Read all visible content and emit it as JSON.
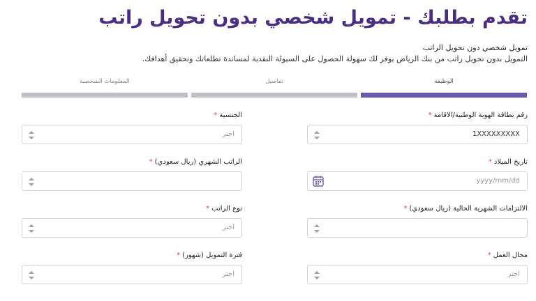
{
  "page": {
    "title": "تقدم بطلبك - تمويل شخصي بدون تحويل راتب",
    "subtitle": "تمويل شخصي دون تحويل الراتب",
    "description": "التمويل بدون تحويل راتب من بنك الرياض يوفر لك سهولة الحصول على السيولة النقدية لمساندة تطلعاتك وتحقيق أهدافك."
  },
  "steps": [
    {
      "label": "الوظيفة",
      "active": true
    },
    {
      "label": "تفاصيل",
      "active": false
    },
    {
      "label": "المعلومات الشخصية",
      "active": false
    }
  ],
  "form": {
    "required_mark": "*",
    "id_number": {
      "label": "رقم بطاقة الهوية الوطنية/الاقامة",
      "value": "1XXXXXXXXX"
    },
    "nationality": {
      "label": "الجنسية",
      "placeholder": "اختر"
    },
    "birth_date": {
      "label": "تاريخ الميلاد",
      "placeholder": "yyyy/mm/dd"
    },
    "monthly_salary": {
      "label": "الراتب الشهري (ريال سعودي)",
      "value": ""
    },
    "monthly_obligations": {
      "label": "الالتزامات الشهرية الحالية (ريال سعودي)",
      "value": ""
    },
    "salary_type": {
      "label": "نوع الراتب",
      "placeholder": "اختر"
    },
    "work_sector": {
      "label": "مجال العمل",
      "placeholder": "اختر"
    },
    "finance_period": {
      "label": "فترة التمويل (شهور)",
      "placeholder": "اختر"
    }
  },
  "icons": {
    "spinner": "select-arrows-icon",
    "calendar": "calendar-icon"
  },
  "colors": {
    "title": "#4b2d83",
    "active_step": "#6a5aad",
    "inactive_step": "#bfc1c6",
    "required": "#e0403c"
  }
}
